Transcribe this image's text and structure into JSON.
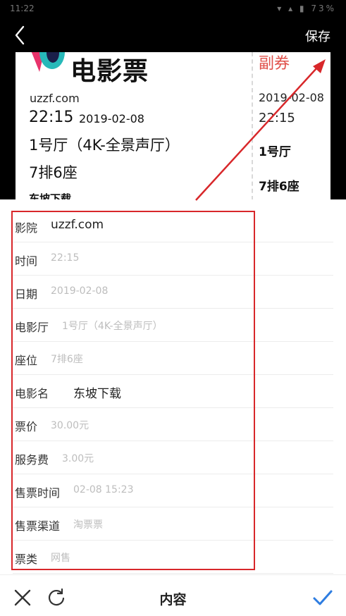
{
  "statusbar": {
    "time": "11:22",
    "icons": "▾ ▴ ▮ 73%"
  },
  "header": {
    "save_label": "保存"
  },
  "ticket": {
    "brand": "电影票",
    "site": "uzzf.com",
    "time": "22:15",
    "date": "2019-02-08",
    "hall": "1号厅（4K-全景声厅）",
    "seat": "7排6座",
    "movie": "东坡下载",
    "stub": {
      "title": "副券",
      "date": "2019-02-08",
      "time": "22:15",
      "hall": "1号厅",
      "seat": "7排6座"
    }
  },
  "form": {
    "rows": [
      {
        "label": "影院",
        "value": "uzzf.com",
        "filled": true
      },
      {
        "label": "时间",
        "value": "22:15",
        "filled": false
      },
      {
        "label": "日期",
        "value": "2019-02-08",
        "filled": false
      },
      {
        "label": "电影厅",
        "value": "1号厅（4K-全景声厅）",
        "filled": false
      },
      {
        "label": "座位",
        "value": "7排6座",
        "filled": false
      },
      {
        "label": "电影名",
        "value": "东坡下载",
        "filled": true
      },
      {
        "label": "票价",
        "value": "30.00元",
        "filled": false
      },
      {
        "label": "服务费",
        "value": "3.00元",
        "filled": false
      },
      {
        "label": "售票时间",
        "value": "02-08 15:23",
        "filled": false
      },
      {
        "label": "售票渠道",
        "value": "淘票票",
        "filled": false
      },
      {
        "label": "票类",
        "value": "网售",
        "filled": false
      }
    ]
  },
  "bottombar": {
    "title": "内容"
  },
  "colors": {
    "accent": "#2e7de1",
    "highlight": "#d8272a",
    "stub_red": "#e0504a"
  }
}
